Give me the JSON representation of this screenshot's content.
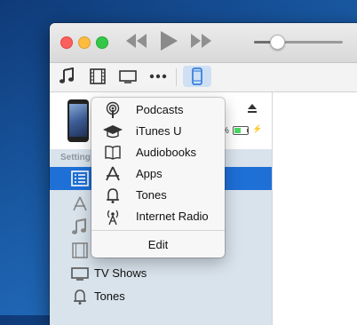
{
  "window": {
    "transport": {
      "prev_icon": "rewind-icon",
      "play_icon": "play-icon",
      "next_icon": "fast-forward-icon"
    },
    "volume": {
      "level": 0.25
    }
  },
  "toolbar": {
    "icons": [
      "music-note-icon",
      "film-icon",
      "tv-icon",
      "more-icon",
      "iphone-icon"
    ]
  },
  "device": {
    "battery_percent_visible": "%",
    "battery_level": 0.5,
    "eject_icon": "eject-icon"
  },
  "sidebar": {
    "section_header": "Setting",
    "items": [
      {
        "label": "",
        "icon": "summary-icon",
        "selected": true
      },
      {
        "label": "",
        "icon": "apps-icon"
      },
      {
        "label": "",
        "icon": "music-icon"
      },
      {
        "label": "",
        "icon": "movies-icon"
      },
      {
        "label": "TV Shows",
        "icon": "tv-icon"
      },
      {
        "label": "Tones",
        "icon": "bell-icon"
      }
    ]
  },
  "menu": {
    "items": [
      {
        "label": "Podcasts",
        "icon": "podcast-icon"
      },
      {
        "label": "iTunes U",
        "icon": "graduation-cap-icon"
      },
      {
        "label": "Audiobooks",
        "icon": "book-icon"
      },
      {
        "label": "Apps",
        "icon": "app-store-icon"
      },
      {
        "label": "Tones",
        "icon": "bell-icon"
      },
      {
        "label": "Internet Radio",
        "icon": "radio-antenna-icon"
      }
    ],
    "edit_label": "Edit"
  },
  "colors": {
    "accent": "#1e6fd6",
    "sidebar_bg": "#d9e3ec"
  }
}
